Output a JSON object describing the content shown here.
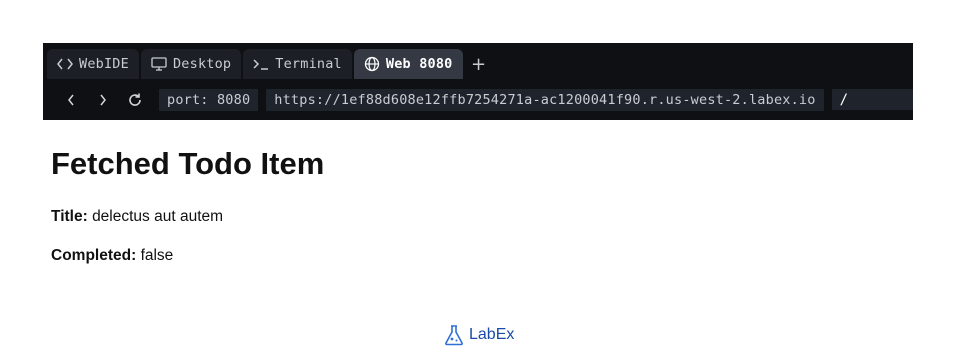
{
  "tabs": [
    {
      "label": "WebIDE",
      "icon": "code-brackets-icon",
      "active": false
    },
    {
      "label": "Desktop",
      "icon": "monitor-icon",
      "active": false
    },
    {
      "label": "Terminal",
      "icon": "terminal-prompt-icon",
      "active": false
    },
    {
      "label": "Web 8080",
      "icon": "globe-icon",
      "active": true
    }
  ],
  "add_tab_label": "+",
  "nav": {
    "back": "‹",
    "forward": "›",
    "reload": "↻"
  },
  "address": {
    "port": "port: 8080",
    "url": "https://1ef88d608e12ffb7254271a-ac1200041f90.r.us-west-2.labex.io",
    "path": "/"
  },
  "page": {
    "heading": "Fetched Todo Item",
    "title_label": "Title:",
    "title_value": "delectus aut autem",
    "completed_label": "Completed:",
    "completed_value": "false"
  },
  "footer": {
    "brand": "LabEx",
    "brand_color": "#1a4aa8"
  },
  "colors": {
    "chrome_bg": "#0f1014",
    "tab_bg": "#1c1f26",
    "tab_active_bg": "#343944",
    "field_bg": "#1f232b"
  }
}
